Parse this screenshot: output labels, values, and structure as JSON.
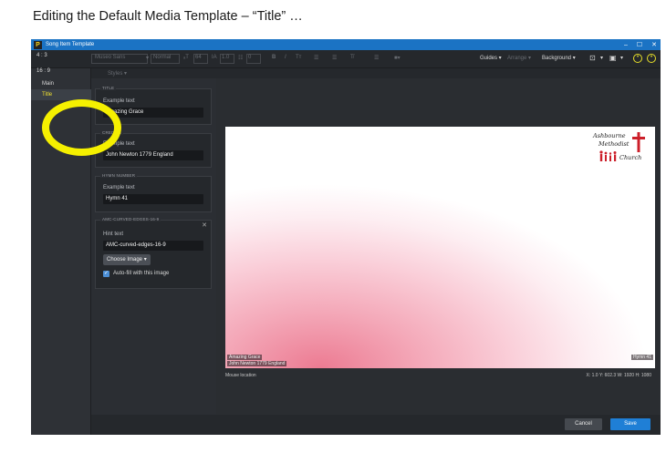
{
  "doc": {
    "title": "Editing the Default Media Template – “Title” …"
  },
  "window": {
    "title": "Song Item Template",
    "app_icon": "P",
    "controls": {
      "minimize": "–",
      "maximize": "☐",
      "close": "✕"
    }
  },
  "toolbar": {
    "font_name": "Museo Sans",
    "font_style": "Normal",
    "size_a": "64",
    "size_b": "1.0",
    "size_c": "0",
    "bold": "B",
    "italic": "I",
    "text_case": "Tт",
    "list_bullet": "☰",
    "list_number": "☰",
    "clear_format": "T̸",
    "align": "☰",
    "guides": "Guides ▾",
    "arrange": "Arrange ▾",
    "background": "Background ▾",
    "styles": "Styles ▾"
  },
  "left_panel": {
    "ratios": [
      "4 : 3",
      "16 : 9"
    ],
    "nav": [
      {
        "label": "Main"
      },
      {
        "label": "Title"
      }
    ]
  },
  "sections": {
    "title": {
      "header": "TITLE",
      "label": "Example text",
      "value": "Amazing Grace"
    },
    "credits": {
      "header": "CREDITS",
      "label": "Example text",
      "value": "John Newton 1779 England"
    },
    "hymn_number": {
      "header": "HYMN NUMBER",
      "label": "Example text",
      "value": "Hymn 41"
    },
    "image": {
      "header": "AMC-CURVED-EDGES-16-9",
      "label": "Hint text",
      "value": "AMC-curved-edges-16-9",
      "choose_image": "Choose Image ▾",
      "autofill": "Auto-fill with this image",
      "close": "✕"
    }
  },
  "slide": {
    "logo": {
      "line1": "Ashbourne",
      "line2": "Methodist",
      "line3": "Church"
    },
    "title_text": "Amazing Grace",
    "credits_text": "John Newton 1779 England",
    "hymn_text": "Hymn 41"
  },
  "status": {
    "mouse_location": "Mouse location",
    "coords": "X: 1.0  Y: 602.3   W: 1920  H: 1080"
  },
  "buttons": {
    "cancel": "Cancel",
    "save": "Save"
  },
  "colors": {
    "accent": "#1f7fd6",
    "highlight": "#f5f000",
    "selected_nav": "#f0e030"
  }
}
